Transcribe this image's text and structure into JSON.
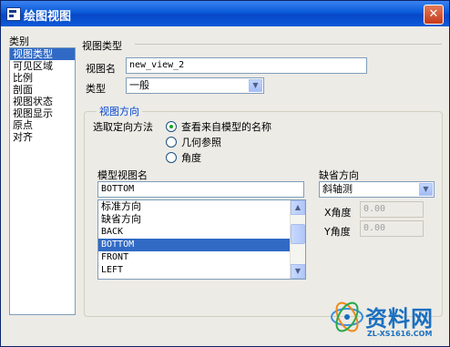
{
  "window": {
    "title": "绘图视图",
    "close_symbol": "✕"
  },
  "categories": {
    "label": "类别",
    "items": [
      "视图类型",
      "可见区域",
      "比例",
      "剖面",
      "视图状态",
      "视图显示",
      "原点",
      "对齐"
    ],
    "selected": "视图类型"
  },
  "view_type": {
    "section_title": "视图类型",
    "name_label": "视图名",
    "name_value": "new_view_2",
    "type_label": "类型",
    "type_value": "一般"
  },
  "orientation": {
    "group_title": "视图方向",
    "method_label": "选取定向方法",
    "options": [
      "查看来自模型的名称",
      "几何参照",
      "角度"
    ],
    "selected_option": "查看来自模型的名称",
    "model_views_label": "模型视图名",
    "model_view_value": "BOTTOM",
    "model_views": [
      "标准方向",
      "缺省方向",
      "BACK",
      "BOTTOM",
      "FRONT",
      "LEFT"
    ],
    "selected_view": "BOTTOM",
    "default_orientation_label": "缺省方向",
    "default_orientation_value": "斜轴测",
    "x_angle_label": "X角度",
    "x_angle_value": "0.00",
    "y_angle_label": "Y角度",
    "y_angle_value": "0.00"
  },
  "watermark": {
    "brand": "资料网",
    "url": "ZL-XS1616.COM"
  },
  "colors": {
    "title_bar": "#0a5ad8",
    "selection": "#316ac5",
    "group_title": "#0046d5"
  }
}
